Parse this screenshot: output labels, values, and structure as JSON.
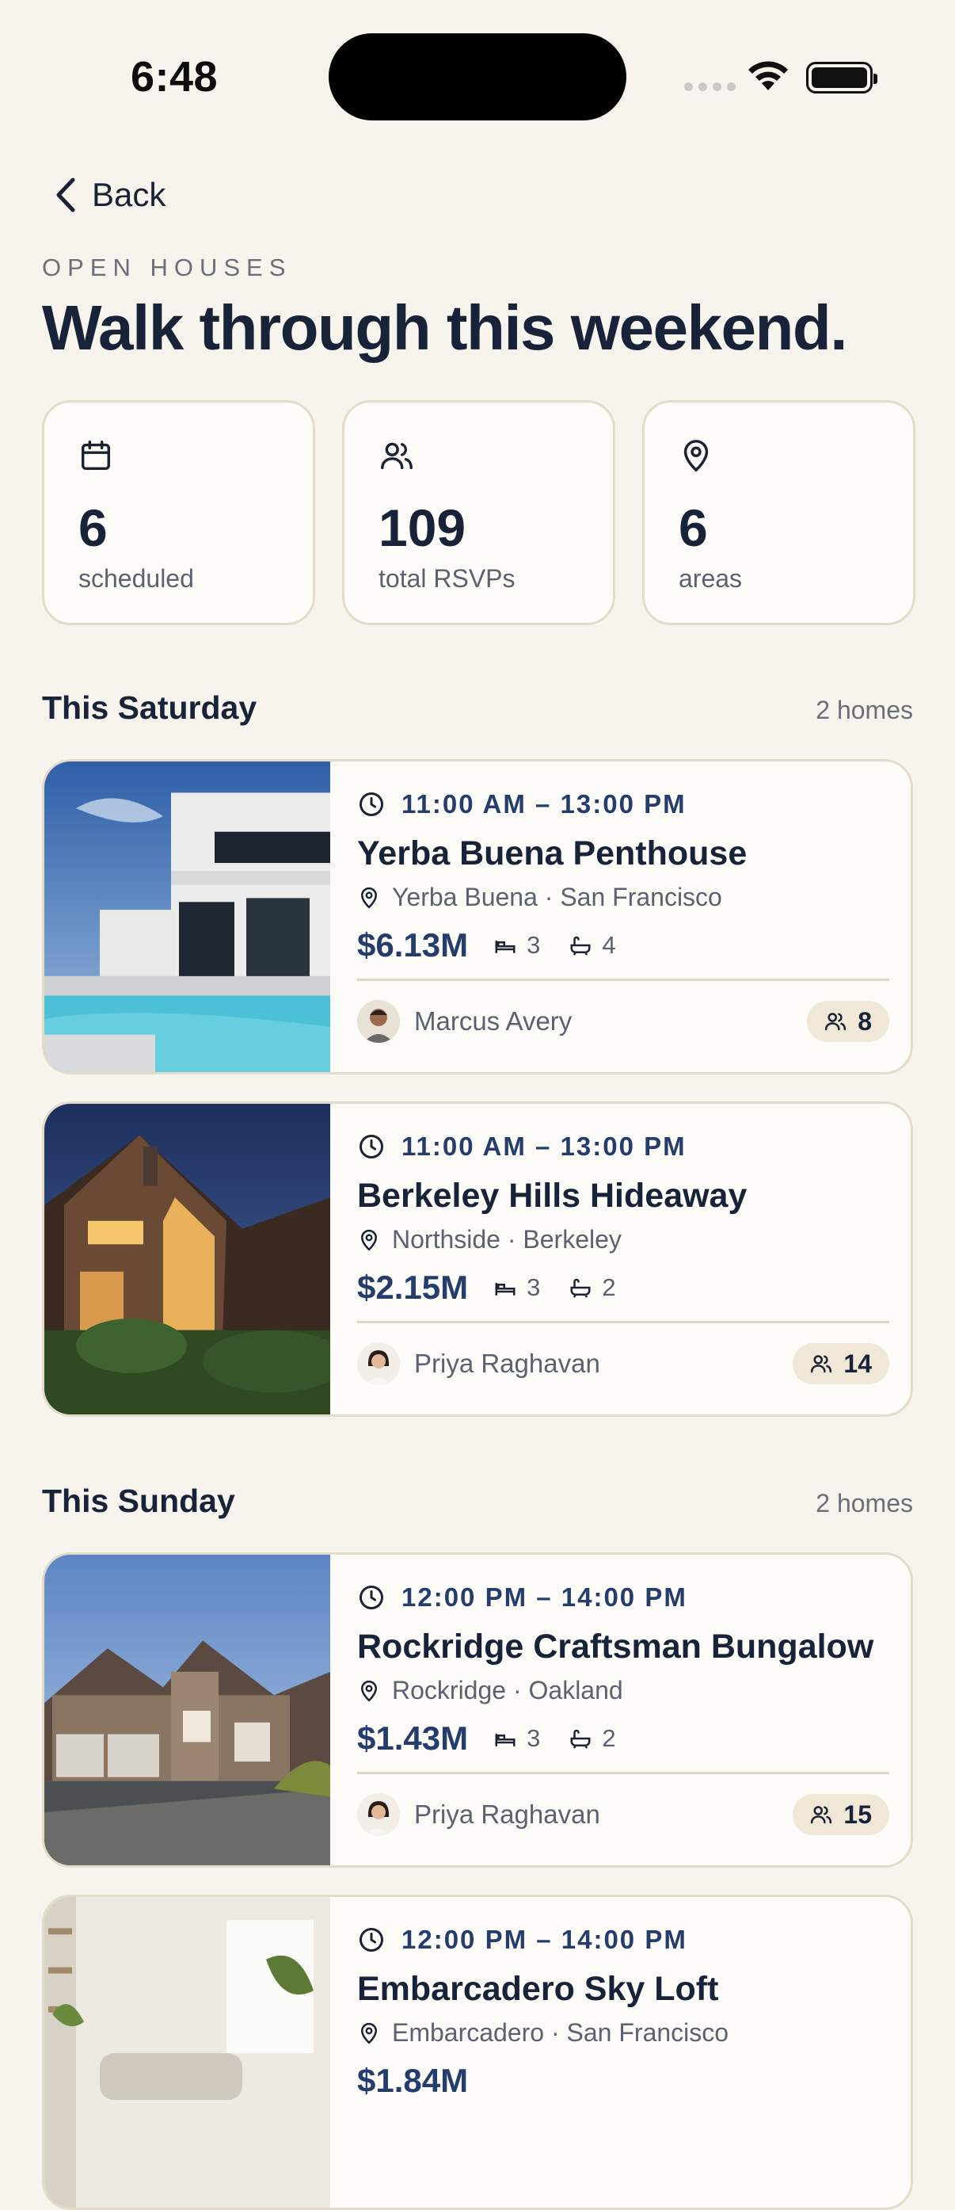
{
  "status": {
    "time": "6:48"
  },
  "nav": {
    "back_label": "Back"
  },
  "header": {
    "eyebrow": "OPEN HOUSES",
    "title": "Walk through this weekend."
  },
  "stats": [
    {
      "icon": "calendar-icon",
      "value": "6",
      "label": "scheduled"
    },
    {
      "icon": "users-icon",
      "value": "109",
      "label": "total RSVPs"
    },
    {
      "icon": "map-pin-icon",
      "value": "6",
      "label": "areas"
    }
  ],
  "sections": [
    {
      "title": "This Saturday",
      "count": "2 homes"
    },
    {
      "title": "This Sunday",
      "count": "2 homes"
    }
  ],
  "listings": [
    {
      "time": "11:00 AM – 13:00 PM",
      "title": "Yerba Buena Penthouse",
      "location": "Yerba Buena · San Francisco",
      "price": "$6.13M",
      "beds": "3",
      "baths": "4",
      "agent": "Marcus Avery",
      "rsvps": "8"
    },
    {
      "time": "11:00 AM – 13:00 PM",
      "title": "Berkeley Hills Hideaway",
      "location": "Northside · Berkeley",
      "price": "$2.15M",
      "beds": "3",
      "baths": "2",
      "agent": "Priya Raghavan",
      "rsvps": "14"
    },
    {
      "time": "12:00 PM – 14:00 PM",
      "title": "Rockridge Craftsman Bungalow",
      "location": "Rockridge · Oakland",
      "price": "$1.43M",
      "beds": "3",
      "baths": "2",
      "agent": "Priya Raghavan",
      "rsvps": "15"
    },
    {
      "time": "12:00 PM – 14:00 PM",
      "title": "Embarcadero Sky Loft",
      "location": "Embarcadero · San Francisco",
      "price": "$1.84M",
      "beds": "",
      "baths": "",
      "agent": "",
      "rsvps": ""
    }
  ],
  "colors": {
    "accent": "#253d6d",
    "background": "#f7f4ee",
    "card": "#fdfcf9",
    "badge": "#f1e7d6"
  }
}
